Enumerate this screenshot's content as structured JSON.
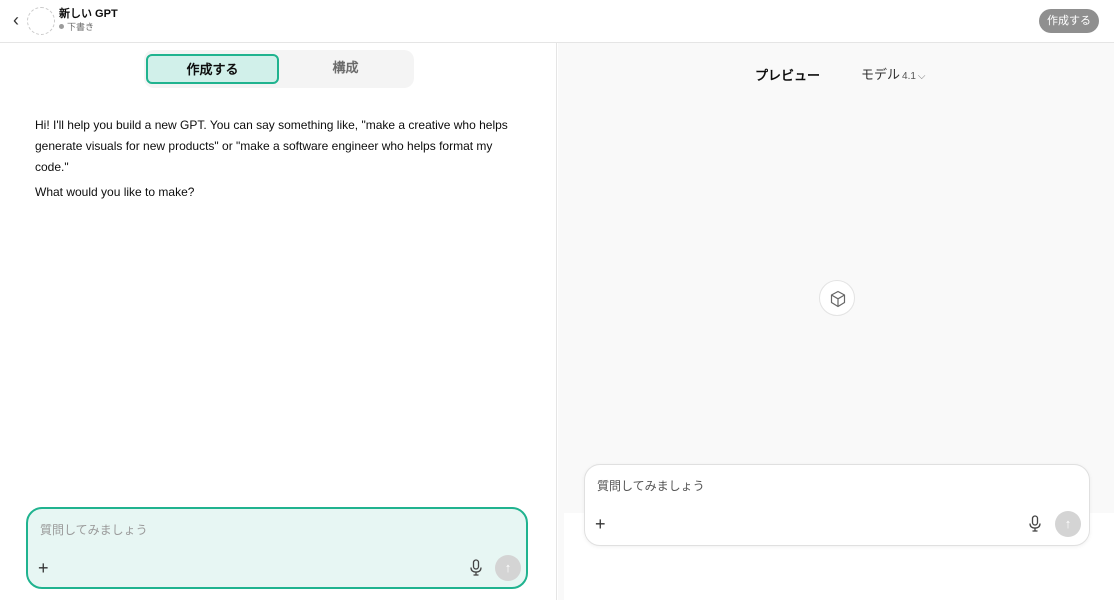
{
  "header": {
    "back_icon": "chevron-left-icon",
    "gpt_name": "新しい GPT",
    "status": "下書き",
    "create_button": "作成する"
  },
  "editor": {
    "tabs": [
      {
        "label": "作成する",
        "active": true
      },
      {
        "label": "構成",
        "active": false
      }
    ],
    "message": [
      "Hi! I'll help you build a new GPT. You can say something like, \"make a creative who helps generate visuals for new products\" or \"make a software engineer who helps format my code.\"",
      "What would you like to make?"
    ],
    "composer": {
      "placeholder": "質問してみましょう",
      "value": ""
    }
  },
  "preview": {
    "title": "プレビュー",
    "model_label": "モデル",
    "model_version": "4.1",
    "placeholder_icon": "cube-icon",
    "composer": {
      "placeholder": "質問してみましょう",
      "value": ""
    }
  },
  "colors": {
    "accent": "#20b38f",
    "accent_light": "#d1f0ea",
    "composer_active_bg": "#e7f6f3",
    "create_button_bg": "#8f8f8f"
  }
}
